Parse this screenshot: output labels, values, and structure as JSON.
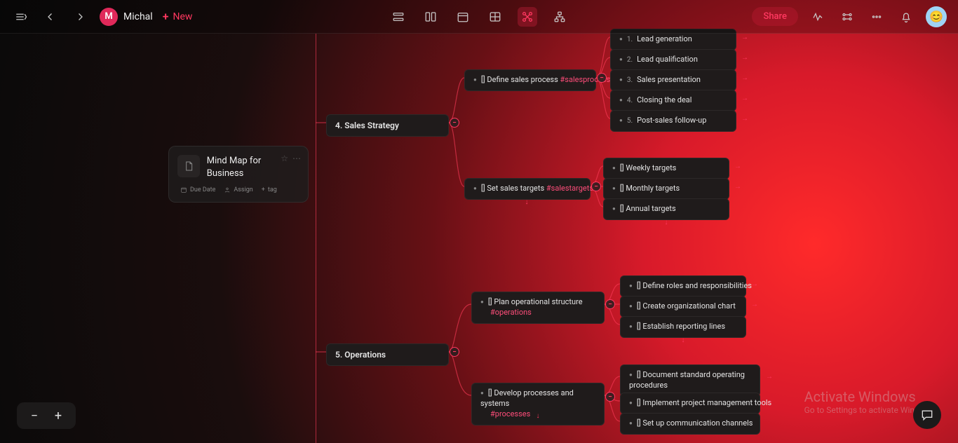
{
  "topbar": {
    "user_initial": "M",
    "user_name": "Michal",
    "new_label": "New",
    "share_label": "Share"
  },
  "root": {
    "title": "Mind Map for Business",
    "due_label": "Due Date",
    "assign_label": "Assign",
    "tag_label": "tag"
  },
  "sections": {
    "sales": {
      "label": "4. Sales Strategy"
    },
    "ops": {
      "label": "5. Operations"
    }
  },
  "sales_process": {
    "label": "[] Define sales process",
    "tag": "#salesprocess",
    "children": [
      "Lead generation",
      "Lead qualification",
      "Sales presentation",
      "Closing the deal",
      "Post-sales follow-up"
    ]
  },
  "sales_targets": {
    "label": "[] Set sales targets",
    "tag": "#salestargets",
    "children": [
      "[] Weekly targets",
      "[] Monthly targets",
      "[] Annual targets"
    ]
  },
  "ops_structure": {
    "label": "[] Plan operational structure",
    "tag": "#operations",
    "children": [
      "[] Define roles and responsibilities",
      "[] Create organizational chart",
      "[] Establish reporting lines"
    ]
  },
  "ops_processes": {
    "label": "[] Develop processes and systems",
    "tag": "#processes",
    "children": [
      "[] Document standard operating procedures",
      "[] Implement project management tools",
      "[] Set up communication channels"
    ]
  },
  "watermark": {
    "line1": "Activate Windows",
    "line2": "Go to Settings to activate Windows."
  }
}
